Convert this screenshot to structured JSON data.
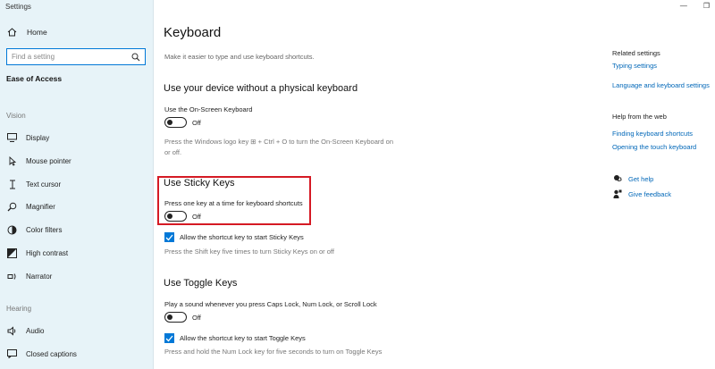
{
  "window": {
    "title": "Settings",
    "minimize": "—",
    "restore": "❐"
  },
  "sidebar": {
    "home": "Home",
    "search_placeholder": "Find a setting",
    "category": "Ease of Access",
    "sections": [
      {
        "label": "Vision",
        "items": [
          {
            "label": "Display",
            "icon": "display-icon"
          },
          {
            "label": "Mouse pointer",
            "icon": "mouse-pointer-icon"
          },
          {
            "label": "Text cursor",
            "icon": "text-cursor-icon"
          },
          {
            "label": "Magnifier",
            "icon": "magnifier-icon"
          },
          {
            "label": "Color filters",
            "icon": "color-filters-icon"
          },
          {
            "label": "High contrast",
            "icon": "high-contrast-icon"
          },
          {
            "label": "Narrator",
            "icon": "narrator-icon"
          }
        ]
      },
      {
        "label": "Hearing",
        "items": [
          {
            "label": "Audio",
            "icon": "audio-icon"
          },
          {
            "label": "Closed captions",
            "icon": "closed-captions-icon"
          }
        ]
      }
    ]
  },
  "main": {
    "title": "Keyboard",
    "subtitle": "Make it easier to type and use keyboard shortcuts.",
    "onscreen": {
      "heading": "Use your device without a physical keyboard",
      "option": "Use the On-Screen Keyboard",
      "state": "Off",
      "help": "Press the Windows logo key ⊞ + Ctrl + O to turn the On-Screen Keyboard on or off."
    },
    "sticky": {
      "heading": "Use Sticky Keys",
      "option": "Press one key at a time for keyboard shortcuts",
      "state": "Off",
      "checkbox": "Allow the shortcut key to start Sticky Keys",
      "help": "Press the Shift key five times to turn Sticky Keys on or off"
    },
    "toggle_keys": {
      "heading": "Use Toggle Keys",
      "option": "Play a sound whenever you press Caps Lock, Num Lock, or Scroll Lock",
      "state": "Off",
      "checkbox": "Allow the shortcut key to start Toggle Keys",
      "help": "Press and hold the Num Lock key for five seconds to turn on Toggle Keys"
    }
  },
  "right": {
    "related_heading": "Related settings",
    "related_links": [
      "Typing settings",
      "Language and keyboard settings"
    ],
    "help_heading": "Help from the web",
    "help_links": [
      "Finding keyboard shortcuts",
      "Opening the touch keyboard"
    ],
    "get_help": "Get help",
    "give_feedback": "Give feedback"
  },
  "colors": {
    "accent": "#0078d7",
    "link": "#0067b8",
    "highlight": "#d51a24",
    "sidebar_bg": "#e7f3f8"
  }
}
